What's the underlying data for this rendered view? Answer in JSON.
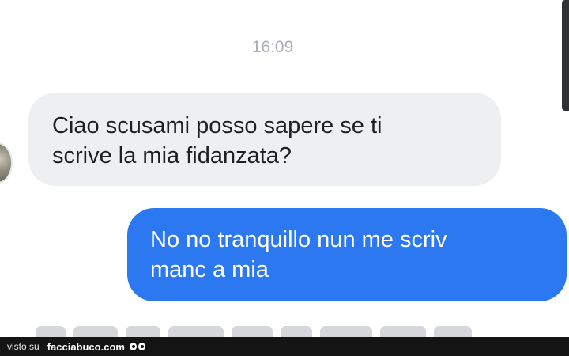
{
  "chat": {
    "timestamp": "16:09",
    "messages": [
      {
        "direction": "incoming",
        "lines": [
          "Ciao scusami posso sapere se ti",
          "scrive la mia fidanzata?"
        ],
        "bubble_color": "#eeeff1"
      },
      {
        "direction": "outgoing",
        "lines": [
          "No no tranquillo nun me scriv",
          "manc a mia"
        ],
        "bubble_color": "#2b78f1"
      }
    ]
  },
  "footer": {
    "prefix": "visto su",
    "site": "facciabuco.com",
    "logo_icon": "eyes-logo-icon"
  },
  "colors": {
    "outgoing_bubble": "#2b78f1",
    "incoming_bubble": "#eeeff1",
    "timestamp_text": "#a9adb4",
    "footer_background": "#141414"
  }
}
